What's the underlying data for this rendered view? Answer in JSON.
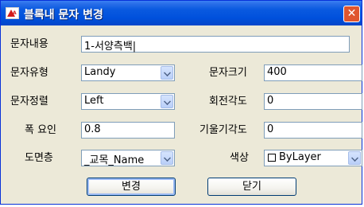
{
  "window": {
    "title": "블록내 문자 변경",
    "app_icon_text": "A"
  },
  "form": {
    "text_content": {
      "label": "문자내용",
      "value": "1-서양측백|"
    },
    "text_style": {
      "label": "문자유형",
      "value": "Landy"
    },
    "text_size": {
      "label": "문자크기",
      "value": "400"
    },
    "justification": {
      "label": "문자정렬",
      "value": "Left"
    },
    "rotation": {
      "label": "회전각도",
      "value": "0"
    },
    "width_factor": {
      "label": "폭 요인",
      "value": "0.8"
    },
    "oblique_angle": {
      "label": "기울기각도",
      "value": "0"
    },
    "layer": {
      "label": "도면층",
      "value": "_교목_Name"
    },
    "color": {
      "label": "색상",
      "value": "ByLayer"
    }
  },
  "buttons": {
    "change": "변경",
    "close": "닫기"
  },
  "colors": {
    "titlebar": "#0050dc",
    "close_button": "#e0562e",
    "dialog_bg": "#ece9d8",
    "field_border": "#7f9db9"
  }
}
